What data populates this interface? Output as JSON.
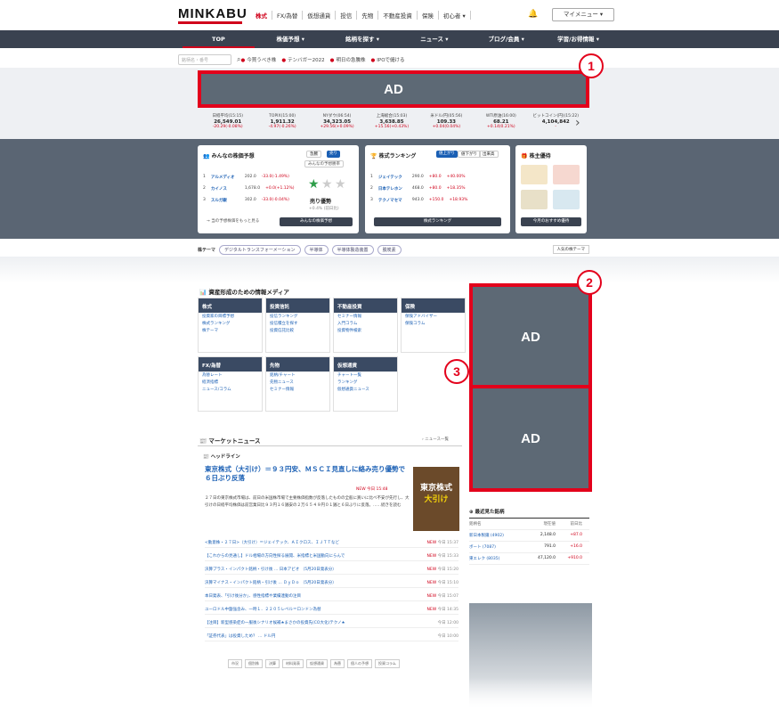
{
  "header": {
    "logo": "MINKABU",
    "nav": [
      "株式",
      "FX/為替",
      "仮想通貨",
      "投信",
      "先物",
      "不動産投資",
      "保険",
      "初心者 ▾"
    ],
    "mymenu": "マイメニュー ▾"
  },
  "mainnav": [
    "TOP",
    "株価予想 ▾",
    "銘柄を探す ▾",
    "ニュース ▾",
    "ブログ/会員 ▾",
    "学習/お得情報 ▾"
  ],
  "search": {
    "placeholder": "銘柄名・番号",
    "trends": [
      "今買うべき株",
      "テンバガー2022",
      "明日の急騰株",
      "IPOで儲ける"
    ]
  },
  "ads": {
    "label": "AD"
  },
  "markers": [
    "1",
    "2",
    "3"
  ],
  "tickers": [
    {
      "name": "日経平均(15:15)",
      "value": "26,549.01",
      "change": "-20.29(-0.08%)"
    },
    {
      "name": "TOPIX(15:00)",
      "value": "1,911.32",
      "change": "-4.97(-0.26%)"
    },
    {
      "name": "NYダウ(06:54)",
      "value": "34,323.05",
      "change": "+29.56(+0.09%)"
    },
    {
      "name": "上海総合(15:03)",
      "value": "3,638.85",
      "change": "+15.56(+0.43%)"
    },
    {
      "name": "米ドル/円(05:56)",
      "value": "109.33",
      "change": "+0.04(0.04%)"
    },
    {
      "name": "WTI原油(16:00)",
      "value": "68.21",
      "change": "+0.14(0.21%)"
    },
    {
      "name": "ビットコイン(円)(15:22)",
      "value": "4,104,842",
      "change": "-"
    }
  ],
  "forecast": {
    "title": "みんなの株価予想",
    "tabs": [
      "急騰",
      "売り"
    ],
    "sub": "みんなの予想勝率",
    "rows": [
      {
        "rank": "1",
        "name": "アルメディオ",
        "price": "202.0",
        "chg": "-33.0(-1.49%)"
      },
      {
        "rank": "2",
        "name": "カイノス",
        "price": "1,678.0",
        "chg": "+0.0(+1.12%)"
      },
      {
        "rank": "3",
        "name": "スルガ銀",
        "price": "302.0",
        "chg": "-33.0(-0.04%)"
      }
    ],
    "rating": "売り優勢",
    "pct": "+0.4% (前日比)",
    "link": "→ 当の予想株価をもっと見る",
    "button": "みんなの株価予想"
  },
  "ranking": {
    "title": "株式ランキング",
    "tabs": [
      "値上がり",
      "値下がり",
      "出来高"
    ],
    "rows": [
      {
        "rank": "1",
        "name": "ジェイテック",
        "price": "290.0",
        "chg": "+80.0",
        "pct": "+40.00%"
      },
      {
        "rank": "2",
        "name": "日本テレホン",
        "price": "468.0",
        "chg": "+80.0",
        "pct": "+18.35%"
      },
      {
        "rank": "3",
        "name": "テクノマセマ",
        "price": "943.0",
        "chg": "+150.0",
        "pct": "+18.93%"
      }
    ],
    "button": "株式ランキング"
  },
  "yutai": {
    "title": "株主優待",
    "button": "今月のおすすめ優待"
  },
  "themes": {
    "label": "株テーマ",
    "chips": [
      "デジタルトランスフォーメーション",
      "半導体",
      "半導体製造装置",
      "脱炭素"
    ],
    "more": "人気の株テーマ"
  },
  "media": {
    "title": "資産形成のための情報メディア",
    "tiles": [
      {
        "name": "株式",
        "items": [
          "投資家の目標予想",
          "株式ランキング",
          "株テーマ"
        ]
      },
      {
        "name": "投資信託",
        "items": [
          "投信ランキング",
          "投信積立を探す",
          "投資信託比較"
        ]
      },
      {
        "name": "不動産投資",
        "items": [
          "セミナー情報",
          "入門コラム",
          "投資物件検索"
        ]
      },
      {
        "name": "保険",
        "items": [
          "保険アドバイザー",
          "保険コラム"
        ]
      },
      {
        "name": "FX/為替",
        "items": [
          "為替レート",
          "経済指標",
          "ニュース/コラム"
        ]
      },
      {
        "name": "先物",
        "items": [
          "銘柄/チャート",
          "先物ニュース",
          "セミナー情報"
        ]
      },
      {
        "name": "仮想通貨",
        "items": [
          "チャート一覧",
          "ランキング",
          "仮想通貨ニュース"
        ]
      }
    ]
  },
  "market_news": {
    "title": "マーケットニュース",
    "more": "› ニュース一覧",
    "sub": "ヘッドライン",
    "headline": "東京株式（大引け）＝９３円安、ＭＳＣＩ見直しに絡み売り優勢で６日ぶり反落",
    "headline_time": "NEW 今日 15:48",
    "body": "２７日の東京株式市場は、前日の米国株市場で主要株価指数が反落したものの全般に買いに比べ不安が先行し、大引けの日経平均株価は前営業日比９３円１６銭安の２万６５４９円０１銭と６日ぶりに反落。……続きを読む",
    "thumb_top": "東京株式",
    "thumb_bottom": "大引け",
    "items": [
      {
        "text": "<動意株・２７日>（大引け）＝ジェイテック、ＡＩクロス、ＩＪＴＴなど",
        "time": "今日 15:37"
      },
      {
        "text": "【これからの見通し】ドル相場の方向性探る展開、米指標と米国動向にらんで",
        "time": "今日 15:33"
      },
      {
        "text": "決算プラス・インパクト銘柄・引け後 … 日本アビオ （5月20日発表分）",
        "time": "今日 15:20"
      },
      {
        "text": "決算マイナス・インパクト銘柄・引け後 … ＤｙＤｏ （5月20日発表分）",
        "time": "今日 15:10"
      },
      {
        "text": "本日発表、「引け後分か」、感性指標や業績連動の注目",
        "time": "今日 15:07"
      },
      {
        "text": "ユーロドル中盤強含み、一時１．２２０５レベル＝ロンドン為替",
        "time": "今日 14:35"
      },
      {
        "text": "【注目】新型感染症の一服後シナリオ候補★まさかの投資先(CO大化)テクノ★",
        "time": "今日 12:00"
      },
      {
        "text": "「証券代表」は投資しため？ … ドル円",
        "time": "今日 10:00"
      }
    ],
    "cats": [
      "市況",
      "個別株",
      "決算",
      "材料発表",
      "仮想通貨",
      "為替",
      "個人の予想",
      "投資コラム"
    ]
  },
  "recent": {
    "title": "最近見た銘柄",
    "cols": [
      "銘柄名",
      "現在値",
      "前日比"
    ],
    "rows": [
      {
        "name": "新日本製鐵 (4902)",
        "price": "2,148.0",
        "chg": "+87.0"
      },
      {
        "name": "ボート (7087)",
        "price": "791.0",
        "chg": "+16.0"
      },
      {
        "name": "東エレク (8035)",
        "price": "47,120.0",
        "chg": "+910.0"
      }
    ]
  }
}
